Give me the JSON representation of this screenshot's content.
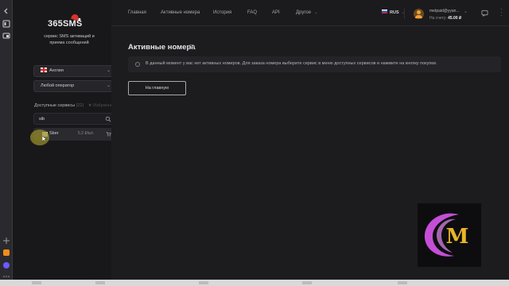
{
  "brand": {
    "logo_text": "365SMS",
    "tagline": "сервис SMS активаций и приема сообщений"
  },
  "sidebar": {
    "country": {
      "label": "Англия",
      "flag": "uk-flag-icon"
    },
    "operator": {
      "label": "Любой оператор"
    },
    "services_title": "Доступные сервисы",
    "services_count": "(22)",
    "favorites_label": "★ Избранное",
    "search": {
      "value": "sib",
      "placeholder": "Поиск"
    },
    "service_row": {
      "name": "Sber",
      "price": "5.2 ₽/шт.",
      "cart": "cart-icon"
    }
  },
  "nav": {
    "items": [
      {
        "label": "Главная"
      },
      {
        "label": "Активные номера"
      },
      {
        "label": "История"
      },
      {
        "label": "FAQ"
      },
      {
        "label": "API"
      },
      {
        "label": "Другое"
      }
    ],
    "language": "RUS",
    "user": {
      "email": "metpaid@yyan...",
      "balance_label": "На счету:",
      "balance_value": "45.00 ₽"
    }
  },
  "main": {
    "title": "Активные номера",
    "alert": "В данный момент у вас нет активных номеров. Для заказа номера выберите сервис в меню доступных сервисов и нажмите на кнопку покупки.",
    "home_button": "На главную"
  },
  "colors": {
    "background": "#1c1c1f",
    "sidebar": "#18181b",
    "accent_red": "#d8342c",
    "watermark_purple": "#c44fd6",
    "watermark_gold": "#e8b62a"
  },
  "watermark": {
    "letter": "M"
  }
}
